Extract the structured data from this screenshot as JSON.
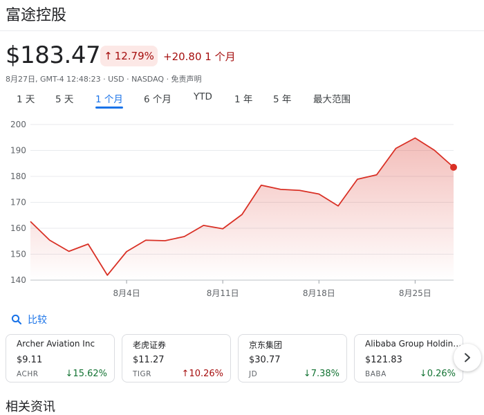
{
  "header": {
    "title": "富途控股"
  },
  "quote": {
    "price": "$183.47",
    "pct_change": "12.79%",
    "abs_change": "+20.80 1 个月",
    "meta": "8月27日, GMT-4 12:48:23 · USD · NASDAQ · 免责声明"
  },
  "ranges": [
    "1 天",
    "5 天",
    "1 个月",
    "6 个月",
    "YTD",
    "1 年",
    "5 年",
    "最大范围"
  ],
  "selected_range": "1 个月",
  "chart_data": {
    "type": "area",
    "color": "#d93025",
    "ylim": [
      140,
      200
    ],
    "y_ticks": [
      "200",
      "190",
      "180",
      "170",
      "160",
      "150",
      "140"
    ],
    "x_tick_labels": [
      "8月4日",
      "8月11日",
      "8月18日",
      "8月25日"
    ],
    "x_tick_index": [
      5,
      10,
      15,
      20
    ],
    "values": [
      162.6,
      155.4,
      151.1,
      153.9,
      141.9,
      151.0,
      155.4,
      155.2,
      156.8,
      161.1,
      159.8,
      165.3,
      176.6,
      175.0,
      174.6,
      173.2,
      168.6,
      178.9,
      180.6,
      190.8,
      194.8,
      190.1,
      183.5
    ]
  },
  "compare": {
    "label": "比较",
    "icon": "search-icon"
  },
  "related": [
    {
      "name": "Archer Aviation Inc",
      "price": "$9.11",
      "ticker": "ACHR",
      "change": "15.62%",
      "direction": "down"
    },
    {
      "name": "老虎证券",
      "price": "$11.27",
      "ticker": "TIGR",
      "change": "10.26%",
      "direction": "up"
    },
    {
      "name": "京东集团",
      "price": "$30.77",
      "ticker": "JD",
      "change": "7.38%",
      "direction": "down"
    },
    {
      "name": "Alibaba Group Holding ...",
      "price": "$121.83",
      "ticker": "BABA",
      "change": "0.26%",
      "direction": "down"
    }
  ],
  "news": {
    "title": "相关资讯"
  },
  "colors": {
    "up": "#a50e0e",
    "down": "#137333",
    "accent": "#1a73e8",
    "line": "#d93025"
  }
}
